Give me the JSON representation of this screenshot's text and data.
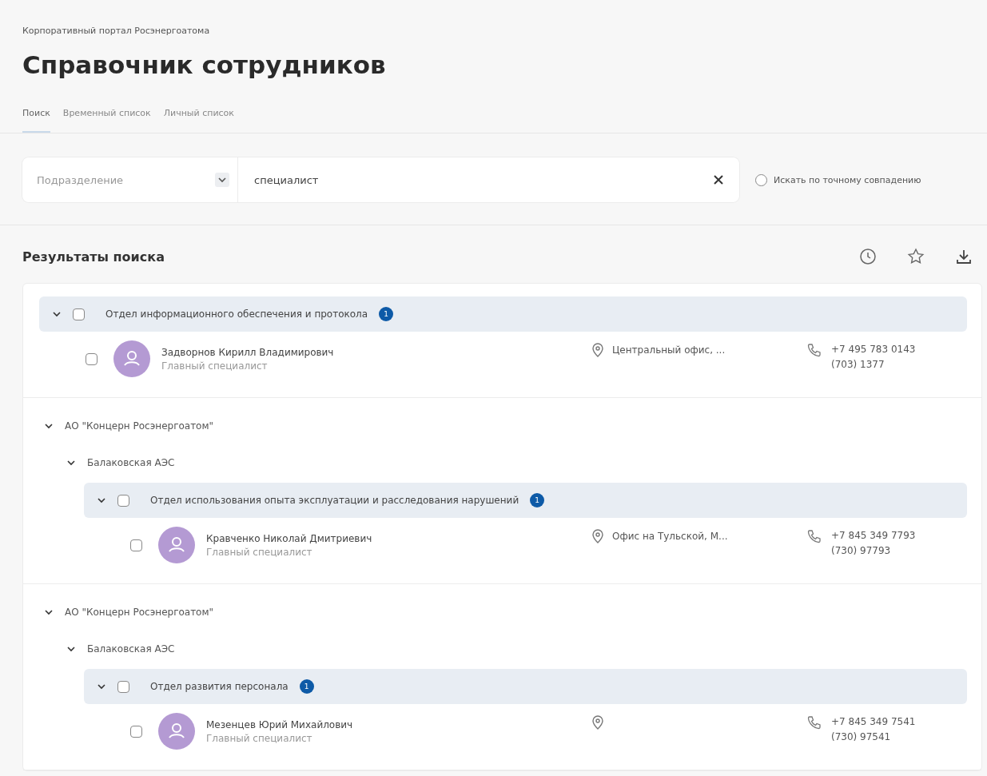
{
  "breadcrumb": "Корпоративный портал Росэнергоатома",
  "title": "Справочник сотрудников",
  "tabs": [
    {
      "label": "Поиск",
      "selected": true
    },
    {
      "label": "Временный список",
      "selected": false
    },
    {
      "label": "Личный список",
      "selected": false
    }
  ],
  "filter": {
    "division_placeholder": "Подразделение",
    "search_value": "специалист",
    "exact_match": {
      "label": "Искать по точному совпадению",
      "checked": false
    }
  },
  "results": {
    "title": "Результаты поиска",
    "sections": [
      {
        "tree": [
          {
            "kind": "department",
            "label": "Отдел информационного обеспечения и протокола",
            "count": "1",
            "expanded": true,
            "checked": false,
            "children": [
              {
                "kind": "employee",
                "name": "Задворнов Кирилл Владимирович",
                "position": "Главный специалист",
                "location": "Центральный офис, ...",
                "phone": "+7 495 783 0143",
                "extension": "(703) 1377",
                "checked": false
              }
            ]
          }
        ]
      },
      {
        "tree": [
          {
            "kind": "org",
            "label": "АО \"Концерн Росэнергоатом\"",
            "expanded": true,
            "children": [
              {
                "kind": "org",
                "label": "Балаковская АЭС",
                "expanded": true,
                "children": [
                  {
                    "kind": "department",
                    "label": "Отдел использования опыта эксплуатации и расследования нарушений",
                    "count": "1",
                    "expanded": true,
                    "checked": false,
                    "children": [
                      {
                        "kind": "employee",
                        "name": "Кравченко Николай Дмитриевич",
                        "position": "Главный специалист",
                        "location": "Офис на Тульской, М...",
                        "phone": "+7 845 349 7793",
                        "extension": "(730) 97793",
                        "checked": false
                      }
                    ]
                  }
                ]
              }
            ]
          }
        ]
      },
      {
        "tree": [
          {
            "kind": "org",
            "label": "АО \"Концерн Росэнергоатом\"",
            "expanded": true,
            "children": [
              {
                "kind": "org",
                "label": "Балаковская АЭС",
                "expanded": true,
                "children": [
                  {
                    "kind": "department",
                    "label": "Отдел развития персонала",
                    "count": "1",
                    "expanded": true,
                    "checked": false,
                    "children": [
                      {
                        "kind": "employee",
                        "name": "Мезенцев Юрий Михайлович",
                        "position": "Главный специалист",
                        "phone": "+7 845 349 7541",
                        "extension": "(730) 97541",
                        "checked": false
                      }
                    ]
                  }
                ]
              }
            ]
          }
        ]
      }
    ]
  }
}
